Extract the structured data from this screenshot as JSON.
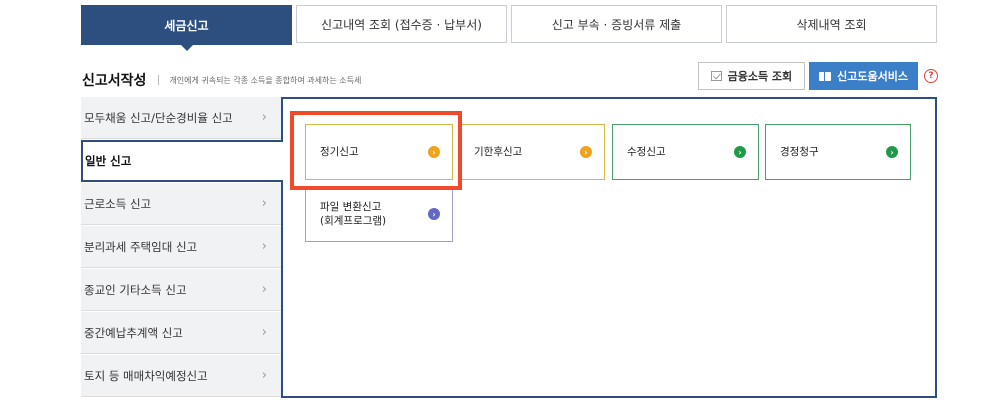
{
  "tabs": [
    {
      "label": "세금신고",
      "active": true
    },
    {
      "label": "신고내역 조회 (접수증 · 납부서)"
    },
    {
      "label": "신고 부속 · 증빙서류 제출"
    },
    {
      "label": "삭제내역 조회"
    }
  ],
  "section": {
    "title": "신고서작성",
    "description": "개인에게 귀속되는 각종 소득을 종합하여 과세하는 소득세"
  },
  "toolbar": {
    "finance_income_lookup": "금융소득 조회",
    "filing_help_service": "신고도움서비스",
    "help_icon": "?"
  },
  "sidebar": {
    "items": [
      {
        "label": "모두채움 신고/단순경비율 신고"
      },
      {
        "label": "일반 신고",
        "active": true
      },
      {
        "label": "근로소득 신고"
      },
      {
        "label": "분리과세 주택임대 신고"
      },
      {
        "label": "종교인 기타소득 신고"
      },
      {
        "label": "중간예납추계액 신고"
      },
      {
        "label": "토지 등 매매차익예정신고"
      }
    ],
    "chevron": "›"
  },
  "cards": [
    {
      "label": "정기신고",
      "color": "#f0a21b"
    },
    {
      "label": "기한후신고",
      "color": "#f0a21b"
    },
    {
      "label": "수정신고",
      "color": "#1f9a4a"
    },
    {
      "label": "경정청구",
      "color": "#1f9a4a"
    },
    {
      "label_line1": "파일 변환신고",
      "label_line2": "(회계프로그램)",
      "color": "#6467c4"
    }
  ],
  "arrow": "›"
}
